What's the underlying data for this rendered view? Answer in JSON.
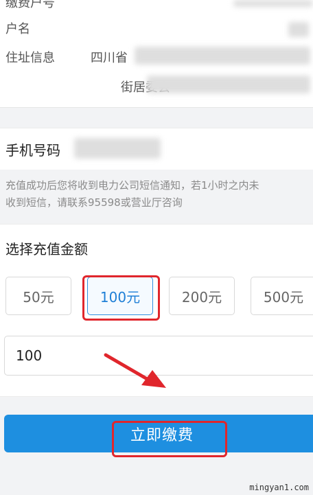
{
  "account_info": {
    "household_label": "缴费户号",
    "name_label": "户名",
    "address_label": "住址信息",
    "address_line1_visible": "四川省",
    "address_line2_visible": "街居委会"
  },
  "phone": {
    "label": "手机号码"
  },
  "notice": {
    "line1": "充值成功后您将收到电力公司短信通知，若1小时之内未",
    "line2": "收到短信，请联系95598或营业厅咨询"
  },
  "amount": {
    "title": "选择充值金额",
    "options": [
      "50元",
      "100元",
      "200元",
      "500元"
    ],
    "selected": "100元",
    "input_value": "100"
  },
  "pay_button_label": "立即缴费",
  "watermark": "mingyan1.com",
  "colors": {
    "accent_blue": "#1e8fe0",
    "highlight_red": "#e0262c"
  }
}
